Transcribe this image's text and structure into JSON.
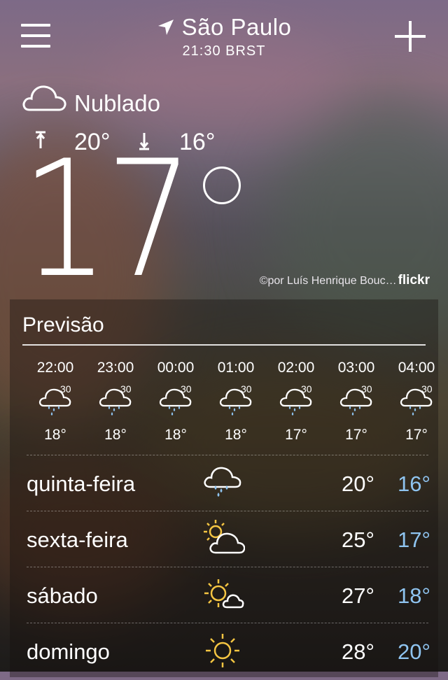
{
  "header": {
    "city": "São Paulo",
    "time": "21:30 BRST"
  },
  "current": {
    "condition": "Nublado",
    "high": "20°",
    "low": "16°",
    "temp": "17",
    "credit": "©por Luís Henrique Bouc…",
    "credit_brand": "flickr"
  },
  "forecast": {
    "title": "Previsão",
    "hourly": [
      {
        "time": "22:00",
        "pct": "30",
        "temp": "18°",
        "icon": "rain-cloud-icon"
      },
      {
        "time": "23:00",
        "pct": "30",
        "temp": "18°",
        "icon": "rain-cloud-icon"
      },
      {
        "time": "00:00",
        "pct": "30",
        "temp": "18°",
        "icon": "rain-cloud-icon"
      },
      {
        "time": "01:00",
        "pct": "30",
        "temp": "18°",
        "icon": "rain-cloud-icon"
      },
      {
        "time": "02:00",
        "pct": "30",
        "temp": "17°",
        "icon": "rain-cloud-icon"
      },
      {
        "time": "03:00",
        "pct": "30",
        "temp": "17°",
        "icon": "rain-cloud-icon"
      },
      {
        "time": "04:00",
        "pct": "30",
        "temp": "17°",
        "icon": "rain-cloud-icon"
      }
    ],
    "daily": [
      {
        "name": "quinta-feira",
        "hi": "20°",
        "lo": "16°",
        "icon": "rain-cloud-icon"
      },
      {
        "name": "sexta-feira",
        "hi": "25°",
        "lo": "17°",
        "icon": "partly-cloudy-icon"
      },
      {
        "name": "sábado",
        "hi": "27°",
        "lo": "18°",
        "icon": "sun-small-cloud-icon"
      },
      {
        "name": "domingo",
        "hi": "28°",
        "lo": "20°",
        "icon": "sun-icon"
      }
    ]
  },
  "colors": {
    "low_temp": "#8fc4f0",
    "rain_drop": "#8fc4f0",
    "sun": "#f5c542"
  }
}
